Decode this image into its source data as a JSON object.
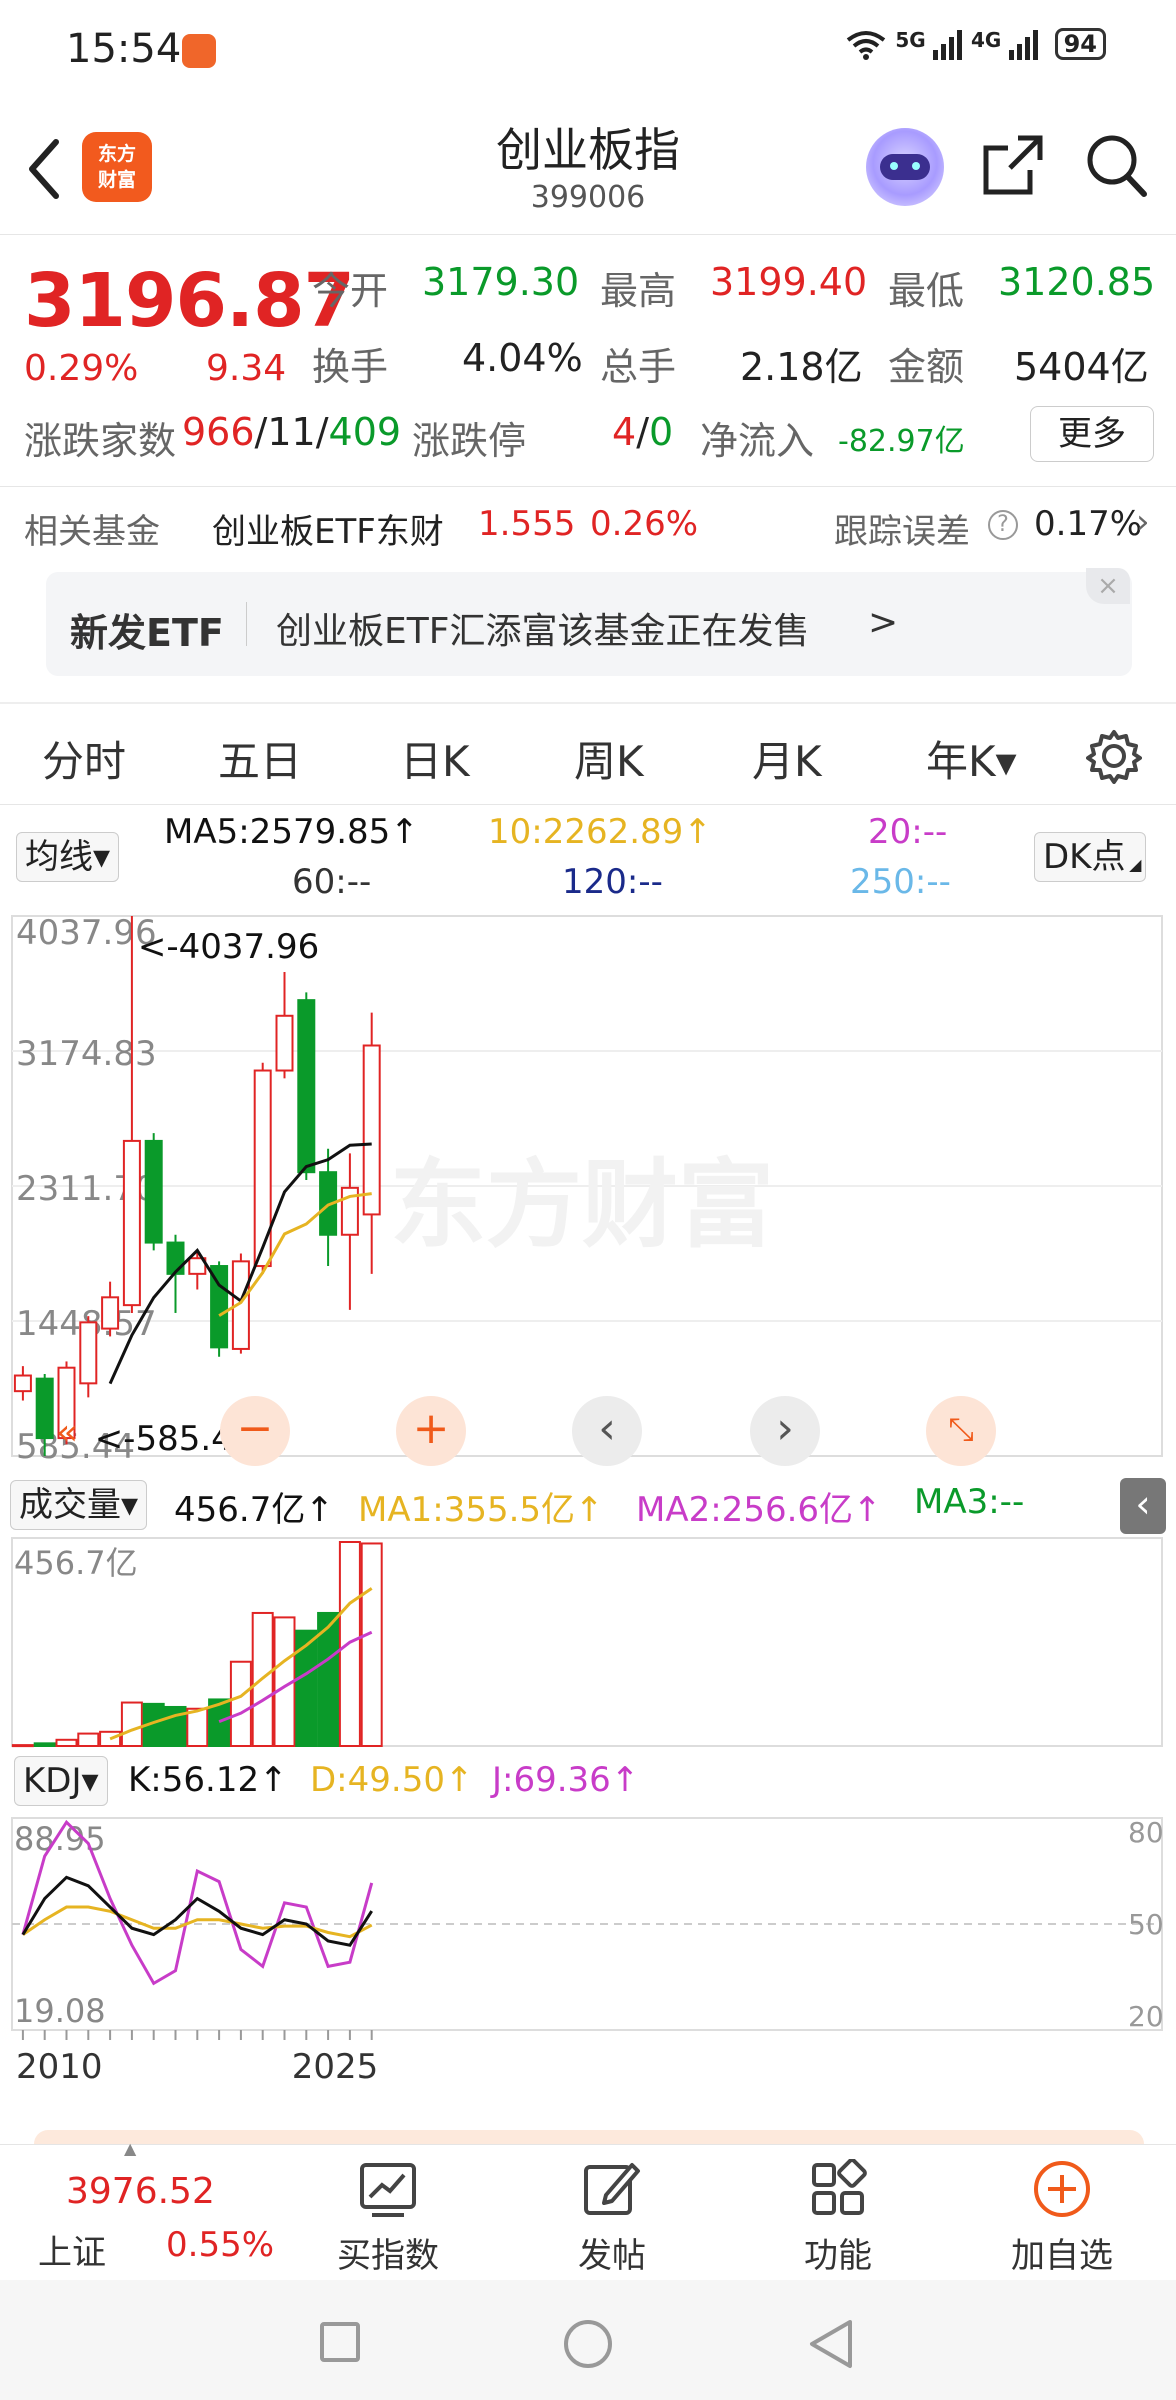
{
  "status_bar": {
    "time": "15:54",
    "network_1": "5G",
    "network_2": "4G",
    "battery": "94"
  },
  "header": {
    "logo_text_1": "东方",
    "logo_text_2": "财富",
    "title": "创业板指",
    "code": "399006"
  },
  "quote": {
    "price": "3196.87",
    "change_pct": "0.29%",
    "change": "9.34",
    "open_label": "今开",
    "open": "3179.30",
    "high_label": "最高",
    "high": "3199.40",
    "low_label": "最低",
    "low": "3120.85",
    "turnover_label": "换手",
    "turnover": "4.04%",
    "volume_label": "总手",
    "volume": "2.18亿",
    "amount_label": "金额",
    "amount": "5404亿",
    "breadth_label": "涨跌家数",
    "up": "966",
    "flat": "11",
    "down": "409",
    "limit_label": "涨跌停",
    "limit_up": "4",
    "limit_down": "0",
    "netflow_label": "净流入",
    "netflow": "-82.97亿",
    "more_label": "更多"
  },
  "fund": {
    "label": "相关基金",
    "name": "创业板ETF东财",
    "price": "1.555",
    "pct": "0.26%",
    "tracking_label": "跟踪误差",
    "tracking": "0.17%"
  },
  "banner": {
    "tag": "新发ETF",
    "text": "创业板ETF汇添富该基金正在发售",
    "arrow": ">"
  },
  "tabs": [
    {
      "label": "分时"
    },
    {
      "label": "五日"
    },
    {
      "label": "日K"
    },
    {
      "label": "周K"
    },
    {
      "label": "月K"
    },
    {
      "label": "年K▾"
    }
  ],
  "ma_panel": {
    "selector": "均线▾",
    "ma5": "MA5:2579.85↑",
    "ma10": "10:2262.89↑",
    "ma20": "20:--",
    "ma60": "60:--",
    "ma120": "120:--",
    "ma250": "250:--",
    "dk_label": "DK点"
  },
  "colors": {
    "up": "#e02424",
    "down": "#0a9a2a",
    "ma5": "#111111",
    "ma10": "#e6b422",
    "ma20": "#c83cc8",
    "ma120": "#1a2a8a",
    "ma250": "#6ab8e8",
    "accent": "#f05a1a"
  },
  "chart_data": [
    {
      "type": "candlestick",
      "y_axis_ticks": [
        "4037.96",
        "3174.83",
        "2311.70",
        "1448.57",
        "585.44"
      ],
      "max_marker": "<-4037.96",
      "min_marker": "<-585.44",
      "watermark": "东方财富",
      "candles": [
        {
          "open": 1000,
          "close": 1100,
          "high": 1160,
          "low": 940
        },
        {
          "open": 1080,
          "close": 700,
          "high": 1110,
          "low": 585.44
        },
        {
          "open": 700,
          "close": 1150,
          "high": 1190,
          "low": 660
        },
        {
          "open": 1050,
          "close": 1440,
          "high": 1480,
          "low": 960
        },
        {
          "open": 1400,
          "close": 1600,
          "high": 1700,
          "low": 1350
        },
        {
          "open": 1550,
          "close": 2600,
          "high": 4037.96,
          "low": 1500
        },
        {
          "open": 2600,
          "close": 1950,
          "high": 2650,
          "low": 1900
        },
        {
          "open": 1950,
          "close": 1750,
          "high": 2000,
          "low": 1500
        },
        {
          "open": 1750,
          "close": 1850,
          "high": 1900,
          "low": 1650
        },
        {
          "open": 1800,
          "close": 1280,
          "high": 1830,
          "low": 1220
        },
        {
          "open": 1270,
          "close": 1830,
          "high": 1880,
          "low": 1240
        },
        {
          "open": 1800,
          "close": 3050,
          "high": 3100,
          "low": 1750
        },
        {
          "open": 3050,
          "close": 3400,
          "high": 3680,
          "low": 3000
        },
        {
          "open": 3500,
          "close": 2400,
          "high": 3550,
          "low": 2350
        },
        {
          "open": 2400,
          "close": 2000,
          "high": 2550,
          "low": 1800
        },
        {
          "open": 2000,
          "close": 2300,
          "high": 2520,
          "low": 1520
        },
        {
          "open": 2130,
          "close": 3210,
          "high": 3420,
          "low": 1750
        }
      ],
      "ma5": [
        null,
        null,
        null,
        null,
        1048,
        1358,
        1598,
        1762,
        1900,
        1678,
        1576,
        1918,
        2274,
        2436,
        2480,
        2572,
        2579.85
      ],
      "ma10": [
        null,
        null,
        null,
        null,
        null,
        null,
        null,
        null,
        null,
        1483,
        1567,
        1758,
        2005,
        2069,
        2190,
        2245,
        2262.89
      ]
    },
    {
      "type": "bar",
      "panel": "成交量",
      "selector": "成交量▾",
      "value_label": "456.7亿↑",
      "ma1": "MA1:355.5亿↑",
      "ma2": "MA2:256.6亿↑",
      "ma3": "MA3:--",
      "y_top_label": "456.7亿",
      "values": [
        2,
        6,
        14,
        28,
        32,
        98,
        95,
        88,
        84,
        105,
        190,
        300,
        290,
        260,
        300,
        460,
        456.7
      ],
      "ma1_values": [
        null,
        null,
        null,
        null,
        16,
        36,
        53,
        69,
        79,
        94,
        112,
        153,
        192,
        227,
        268,
        322,
        355.5
      ],
      "ma2_values": [
        null,
        null,
        null,
        null,
        null,
        null,
        null,
        null,
        null,
        55,
        74,
        103,
        134,
        163,
        196,
        234,
        256.6
      ]
    },
    {
      "type": "line",
      "panel": "KDJ",
      "selector": "KDJ▾",
      "k_label": "K:56.12↑",
      "d_label": "D:49.50↑",
      "j_label": "J:69.36↑",
      "y_max_label": "88.95",
      "y_min_label": "19.08",
      "right_ticks": [
        "80",
        "50",
        "20"
      ],
      "x_labels": [
        "2010",
        "2025"
      ],
      "k": [
        45,
        62,
        72,
        68,
        58,
        48,
        45,
        52,
        62,
        56,
        48,
        45,
        52,
        50,
        42,
        40,
        56.12
      ],
      "d": [
        45,
        52,
        58,
        58,
        56,
        52,
        48,
        48,
        52,
        52,
        50,
        48,
        49,
        49,
        46,
        44,
        49.5
      ],
      "j": [
        45,
        82,
        98,
        88,
        62,
        40,
        22,
        28,
        75,
        70,
        38,
        30,
        60,
        58,
        30,
        32,
        69.36
      ]
    }
  ],
  "bottom_bar": {
    "sh_price": "3976.52",
    "sh_label": "上证",
    "sh_pct": "0.55%",
    "buy_index": "买指数",
    "post": "发帖",
    "functions": "功能",
    "add_watch": "加自选"
  }
}
